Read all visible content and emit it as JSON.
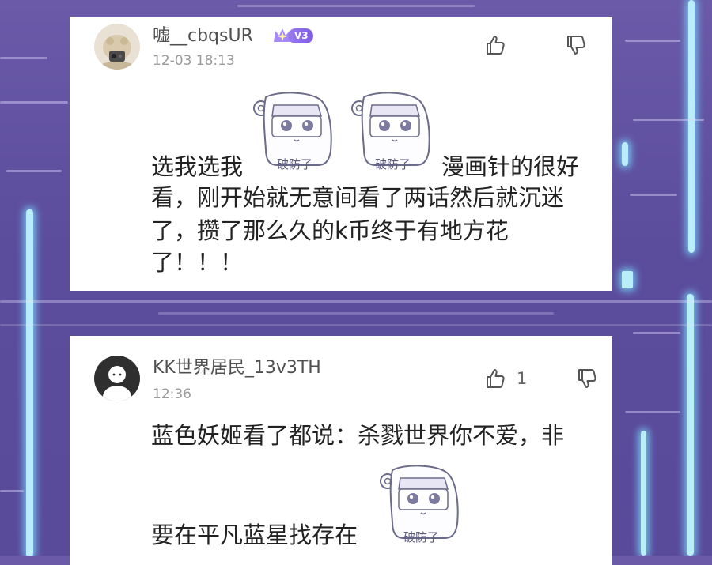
{
  "comments": [
    {
      "username": "嘘__cbqsUR",
      "badge": "V3",
      "timestamp": "12-03 18:13",
      "text_lines": [
        "选我选我",
        "漫画针的很好",
        "看，刚开始就无意间看了两话然后就沉迷",
        "了，攒了那么久的k币终于有地方花",
        "了！！！"
      ],
      "stickers": [
        "破防了",
        "破防了"
      ],
      "likes": ""
    },
    {
      "username": "KK世界居民_13v3TH",
      "badge": "",
      "timestamp": "12:36",
      "text_lines": [
        "蓝色妖姬看了都说：杀戮世界你不爱，非",
        "要在平凡蓝星找存在"
      ],
      "stickers": [
        "破防了"
      ],
      "likes": "1"
    }
  ],
  "icons": {
    "like": "thumbs-up-icon",
    "dislike": "thumbs-down-icon",
    "badge": "crown-icon"
  },
  "colors": {
    "background": "#5b4c9c",
    "card": "#ffffff",
    "badge": "#8a6cf0",
    "neon": "#bff5ff"
  }
}
